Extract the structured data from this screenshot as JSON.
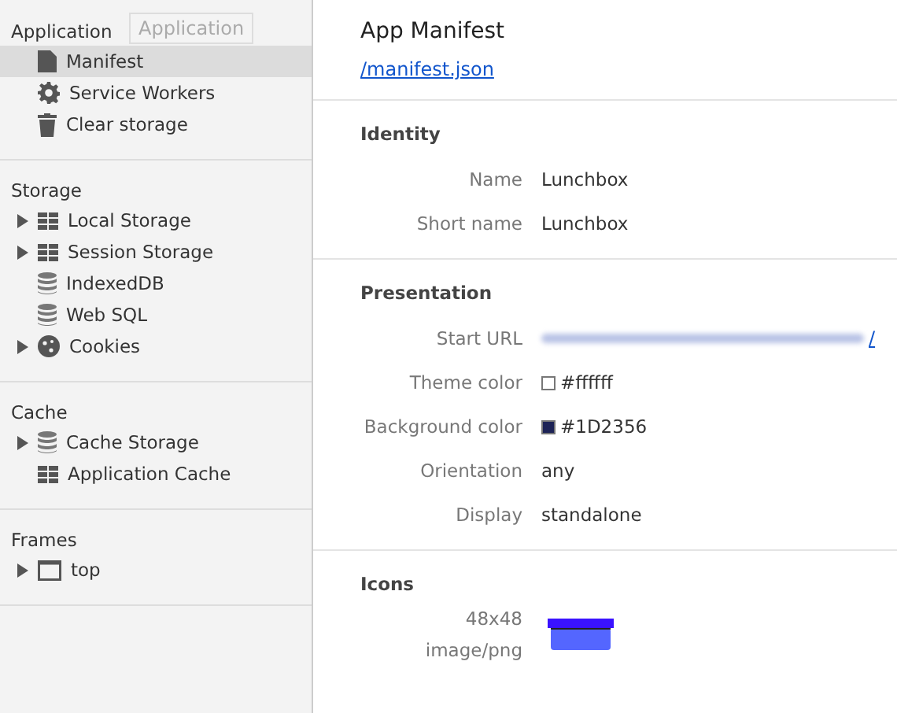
{
  "sidebar": {
    "sections": [
      {
        "title": "Application",
        "items": [
          {
            "label": "Manifest",
            "kind": "document",
            "expandable": false,
            "selected": true
          },
          {
            "label": "Service Workers",
            "kind": "worker",
            "expandable": false,
            "selected": false
          },
          {
            "label": "Clear storage",
            "kind": "clear",
            "expandable": false,
            "selected": false
          }
        ]
      },
      {
        "title": "Storage",
        "items": [
          {
            "label": "Local Storage",
            "kind": "table",
            "expandable": true,
            "selected": false
          },
          {
            "label": "Session Storage",
            "kind": "table",
            "expandable": true,
            "selected": false
          },
          {
            "label": "IndexedDB",
            "kind": "database",
            "expandable": false,
            "selected": false
          },
          {
            "label": "Web SQL",
            "kind": "database",
            "expandable": false,
            "selected": false
          },
          {
            "label": "Cookies",
            "kind": "cookies",
            "expandable": true,
            "selected": false
          }
        ]
      },
      {
        "title": "Cache",
        "items": [
          {
            "label": "Cache Storage",
            "kind": "database",
            "expandable": true,
            "selected": false
          },
          {
            "label": "Application Cache",
            "kind": "table",
            "expandable": false,
            "selected": false
          }
        ]
      },
      {
        "title": "Frames",
        "items": [
          {
            "label": "top",
            "kind": "frame",
            "expandable": true,
            "selected": false
          }
        ]
      }
    ]
  },
  "tooltip": "Application",
  "main": {
    "title": "App Manifest",
    "link": "/manifest.json",
    "sections": [
      {
        "title": "Identity",
        "rows": [
          {
            "kind": "text",
            "labels": [
              "Name"
            ],
            "value": "Lunchbox"
          },
          {
            "kind": "text",
            "labels": [
              "Short name"
            ],
            "value": "Lunchbox"
          }
        ]
      },
      {
        "title": "Presentation",
        "rows": [
          {
            "kind": "blurred-link",
            "labels": [
              "Start URL"
            ],
            "value": "/"
          },
          {
            "kind": "color",
            "labels": [
              "Theme color"
            ],
            "value": "#ffffff",
            "color": "#ffffff"
          },
          {
            "kind": "color",
            "labels": [
              "Background color"
            ],
            "value": "#1D2356",
            "color": "#1d2356"
          },
          {
            "kind": "text",
            "labels": [
              "Orientation"
            ],
            "value": "any"
          },
          {
            "kind": "text",
            "labels": [
              "Display"
            ],
            "value": "standalone"
          }
        ]
      },
      {
        "title": "Icons",
        "rows": [
          {
            "kind": "icon",
            "labels": [
              "48x48",
              "image/png"
            ]
          }
        ]
      }
    ]
  }
}
